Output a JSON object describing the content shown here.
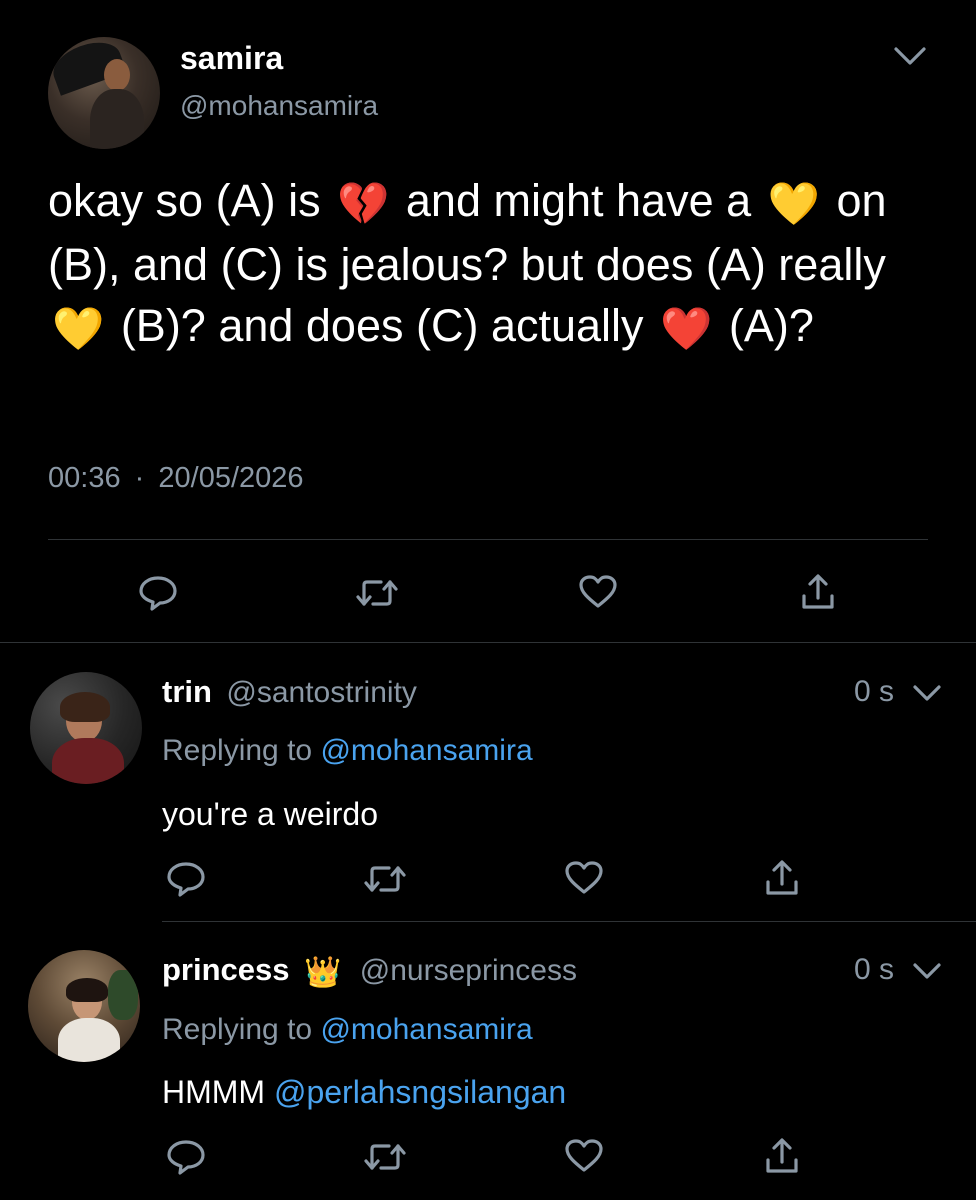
{
  "main_tweet": {
    "author": {
      "name": "samira",
      "handle": "@mohansamira"
    },
    "text_parts": {
      "p1": "okay so (A) is",
      "e1": "💔",
      "p2": "and might have a",
      "e2": "💛",
      "p3": "on (B), and (C) is jealous? but does (A) really",
      "e3": "💛",
      "p4": "(B)? and does (C) actually",
      "e4": "❤️",
      "p5": "(A)?"
    },
    "time": "00:36",
    "separator": "·",
    "date": "20/05/2026",
    "actions": [
      "reply-icon",
      "retweet-icon",
      "like-icon",
      "share-icon"
    ]
  },
  "replies": [
    {
      "name": "trin",
      "handle": "@santostrinity",
      "time": "0 s",
      "replying_prefix": "Replying to",
      "replying_to": "@mohansamira",
      "text": "you're a weirdo"
    },
    {
      "name": "princess",
      "badge_emoji": "👑",
      "handle": "@nurseprincess",
      "time": "0 s",
      "replying_prefix": "Replying to",
      "replying_to": "@mohansamira",
      "text_prefix": "HMMM",
      "text_mention": "@perlahsngsilangan"
    }
  ],
  "colors": {
    "background": "#000000",
    "text_primary": "#ffffff",
    "text_secondary": "#8b98a5",
    "accent_link": "#4aa3ef",
    "divider": "#2f3336"
  }
}
